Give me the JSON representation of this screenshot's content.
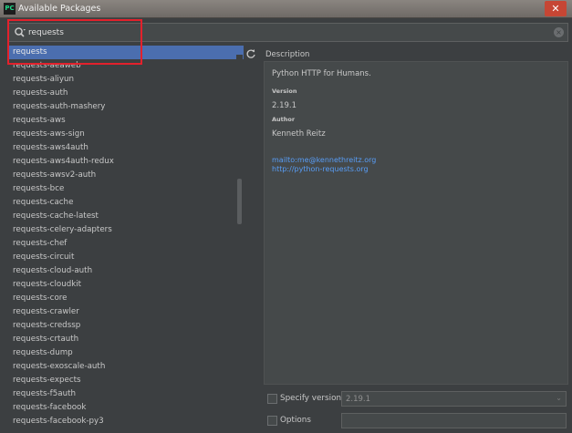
{
  "window": {
    "title": "Available Packages",
    "app_icon_text": "PC",
    "close_glyph": "✕"
  },
  "search": {
    "value": "requests",
    "clear_glyph": "×"
  },
  "packages": [
    "requests",
    "requests-aeaweb",
    "requests-aliyun",
    "requests-auth",
    "requests-auth-mashery",
    "requests-aws",
    "requests-aws-sign",
    "requests-aws4auth",
    "requests-aws4auth-redux",
    "requests-awsv2-auth",
    "requests-bce",
    "requests-cache",
    "requests-cache-latest",
    "requests-celery-adapters",
    "requests-chef",
    "requests-circuit",
    "requests-cloud-auth",
    "requests-cloudkit",
    "requests-core",
    "requests-crawler",
    "requests-credssp",
    "requests-crtauth",
    "requests-dump",
    "requests-exoscale-auth",
    "requests-expects",
    "requests-f5auth",
    "requests-facebook",
    "requests-facebook-py3"
  ],
  "selected_index": 0,
  "description": {
    "header": "Description",
    "summary": "Python HTTP for Humans.",
    "version_label": "Version",
    "version_value": "2.19.1",
    "author_label": "Author",
    "author_value": "Kenneth Reitz",
    "link_mail": "mailto:me@kennethreitz.org",
    "link_home": "http://python-requests.org"
  },
  "options": {
    "specify_version_label": "Specify version",
    "specify_version_value": "2.19.1",
    "options_label": "Options",
    "options_value": ""
  },
  "colors": {
    "selection": "#4b6eaf",
    "link": "#589df6",
    "annotation_box": "#e3212c",
    "panel_bg": "#3c3f41"
  }
}
